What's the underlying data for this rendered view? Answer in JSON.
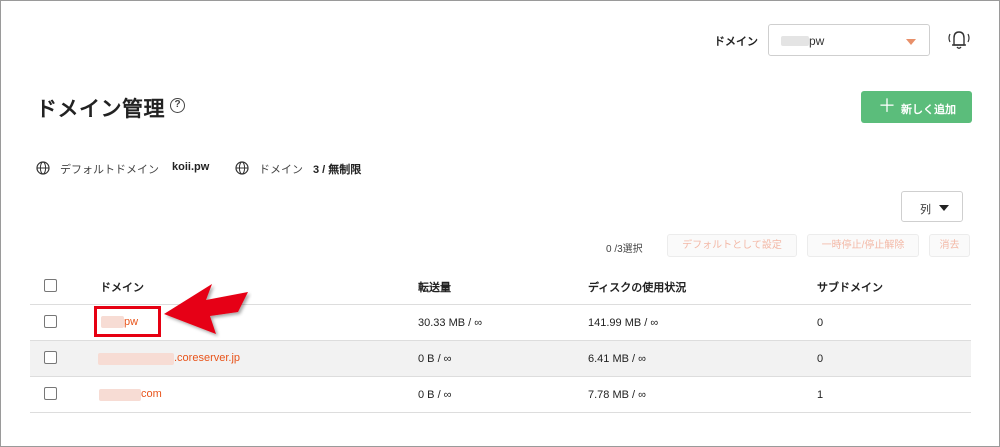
{
  "topbar": {
    "domain_label": "ドメイン",
    "selected_domain": "pw"
  },
  "page": {
    "title": "ドメイン管理",
    "help_symbol": "?"
  },
  "add_button": {
    "plus": "＋",
    "label": "新しく追加"
  },
  "info": {
    "default_label": "デフォルトドメイン",
    "default_value": "koii.pw",
    "count_label": "ドメイン",
    "count_value": "3 / 無制限"
  },
  "columns_button": {
    "label": "列"
  },
  "selection": {
    "count": "0 /3選択",
    "actions": [
      "デフォルトとして設定",
      "一時停止/停止解除",
      "消去"
    ]
  },
  "table": {
    "headers": [
      "ドメイン",
      "転送量",
      "ディスクの使用状況",
      "サブドメイン"
    ],
    "rows": [
      {
        "domain": "pw",
        "transfer": "30.33 MB / ∞",
        "disk": "141.99 MB / ∞",
        "subdomains": "0"
      },
      {
        "domain": ".coreserver.jp",
        "transfer": "0 B / ∞",
        "disk": "6.41 MB / ∞",
        "subdomains": "0"
      },
      {
        "domain": "com",
        "transfer": "0 B / ∞",
        "disk": "7.78 MB / ∞",
        "subdomains": "1"
      }
    ]
  },
  "colors": {
    "accent_green": "#5bbd7b",
    "link_orange": "#e8541b",
    "highlight_red": "#e60012"
  }
}
